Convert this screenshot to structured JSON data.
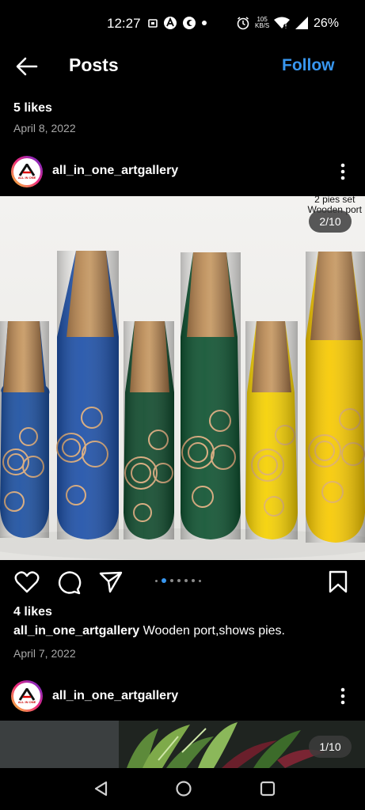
{
  "status_bar": {
    "time": "12:27",
    "speed_value": "105",
    "speed_unit": "KB/S",
    "battery": "26%"
  },
  "header": {
    "back_icon": "arrow-left-icon",
    "title": "Posts",
    "follow_label": "Follow"
  },
  "previous_post": {
    "likes": "5 likes",
    "date": "April 8, 2022"
  },
  "post": {
    "username": "all_in_one_artgallery",
    "avatar_text": "ALL IN ONE",
    "image_caption_line1": "2 pies set",
    "image_caption_line2": "Wooden port",
    "counter": "2/10",
    "carousel_dots": 7,
    "carousel_active_index": 1,
    "likes": "4 likes",
    "caption_user": "all_in_one_artgallery",
    "caption_text": " Wooden port,shows pies.",
    "date": "April 7, 2022",
    "vase_colors": [
      "#1b4fa0",
      "#1d50a8",
      "#0f4a2c",
      "#0e5230",
      "#f5d000",
      "#f7c900"
    ]
  },
  "next_post": {
    "username": "all_in_one_artgallery",
    "counter": "1/10"
  },
  "colors": {
    "accent": "#3897f0",
    "background": "#000000",
    "secondary_text": "#a8a8a8"
  }
}
